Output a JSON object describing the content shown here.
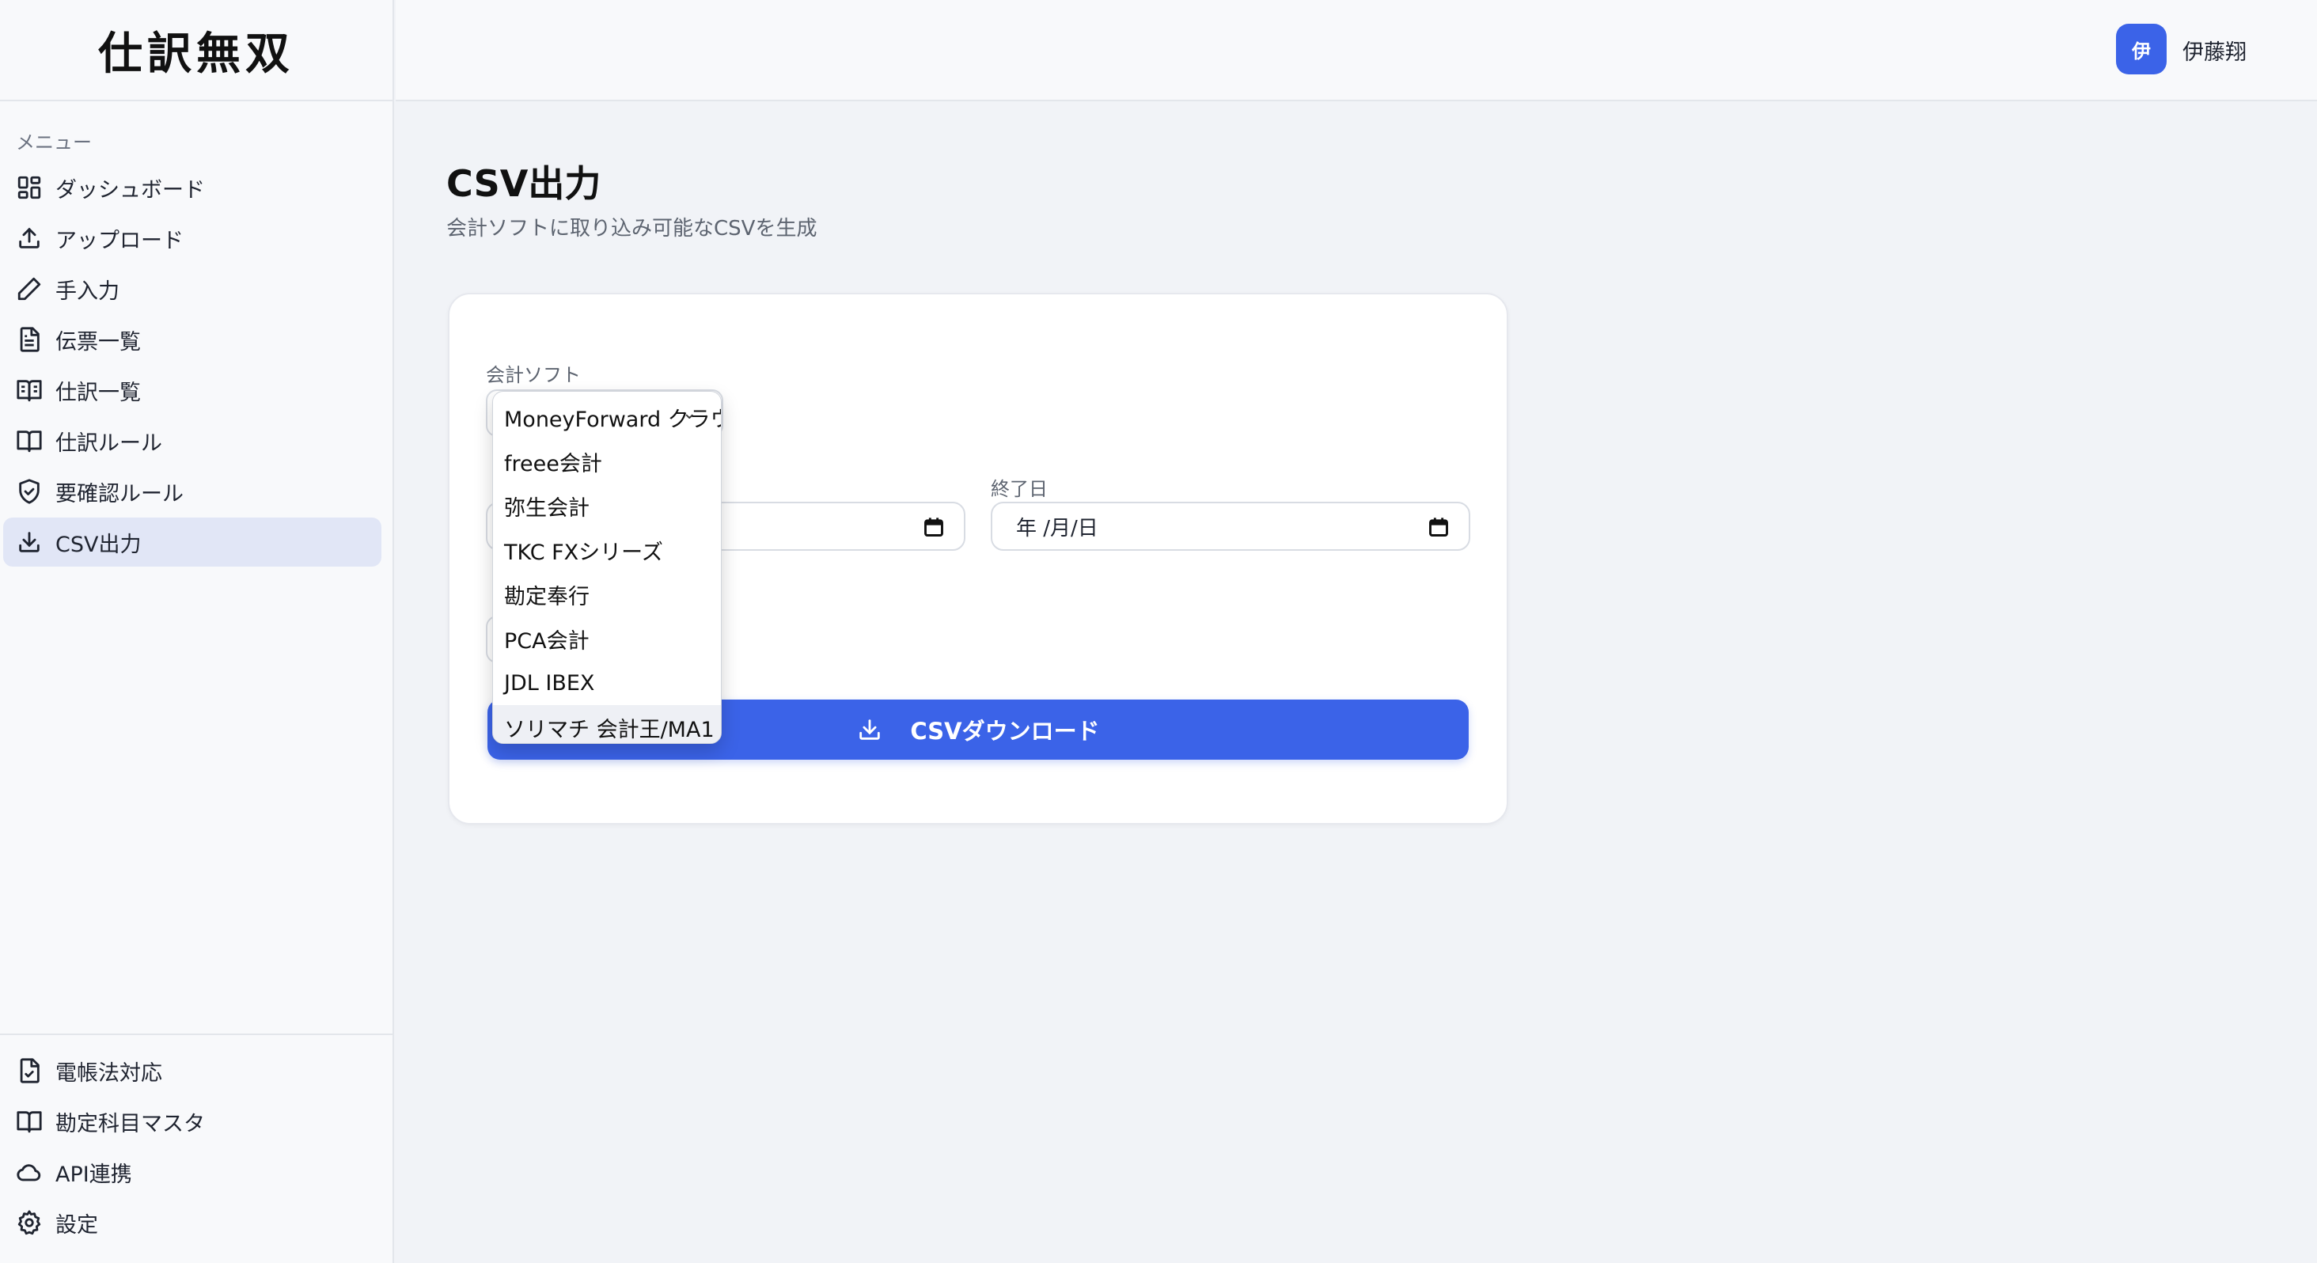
{
  "app": {
    "logo": "仕訳無双"
  },
  "sidebar": {
    "menu_heading": "メニュー",
    "items": [
      {
        "label": "ダッシュボード",
        "icon": "dashboard-icon"
      },
      {
        "label": "アップロード",
        "icon": "upload-icon"
      },
      {
        "label": "手入力",
        "icon": "pencil-icon"
      },
      {
        "label": "伝票一覧",
        "icon": "document-icon"
      },
      {
        "label": "仕訳一覧",
        "icon": "open-book-icon"
      },
      {
        "label": "仕訳ルール",
        "icon": "book-icon"
      },
      {
        "label": "要確認ルール",
        "icon": "shield-check-icon"
      },
      {
        "label": "CSV出力",
        "icon": "download-icon",
        "active": true
      }
    ],
    "bottom_items": [
      {
        "label": "電帳法対応",
        "icon": "file-icon"
      },
      {
        "label": "勘定科目マスタ",
        "icon": "book-icon"
      },
      {
        "label": "API連携",
        "icon": "cloud-icon"
      },
      {
        "label": "設定",
        "icon": "gear-icon"
      }
    ]
  },
  "header": {
    "avatar_initial": "伊",
    "user_name": "伊藤翔"
  },
  "main": {
    "title": "CSV出力",
    "subtitle": "会計ソフトに取り込み可能なCSVを生成",
    "form": {
      "software_label": "会計ソフト",
      "end_date_label": "終了日",
      "end_date_placeholder": "年 /月/日",
      "download_label": "CSVダウンロード"
    },
    "dropdown": {
      "options": [
        "MoneyForward クラウ",
        "freee会計",
        "弥生会計",
        "TKC FXシリーズ",
        "勘定奉行",
        "PCA会計",
        "JDL IBEX",
        "ソリマチ 会計王/MA1"
      ],
      "highlighted_index": 7
    }
  },
  "colors": {
    "accent": "#3b63e8",
    "active_nav_bg": "#e1e6f6",
    "page_bg": "#f1f3f7"
  }
}
